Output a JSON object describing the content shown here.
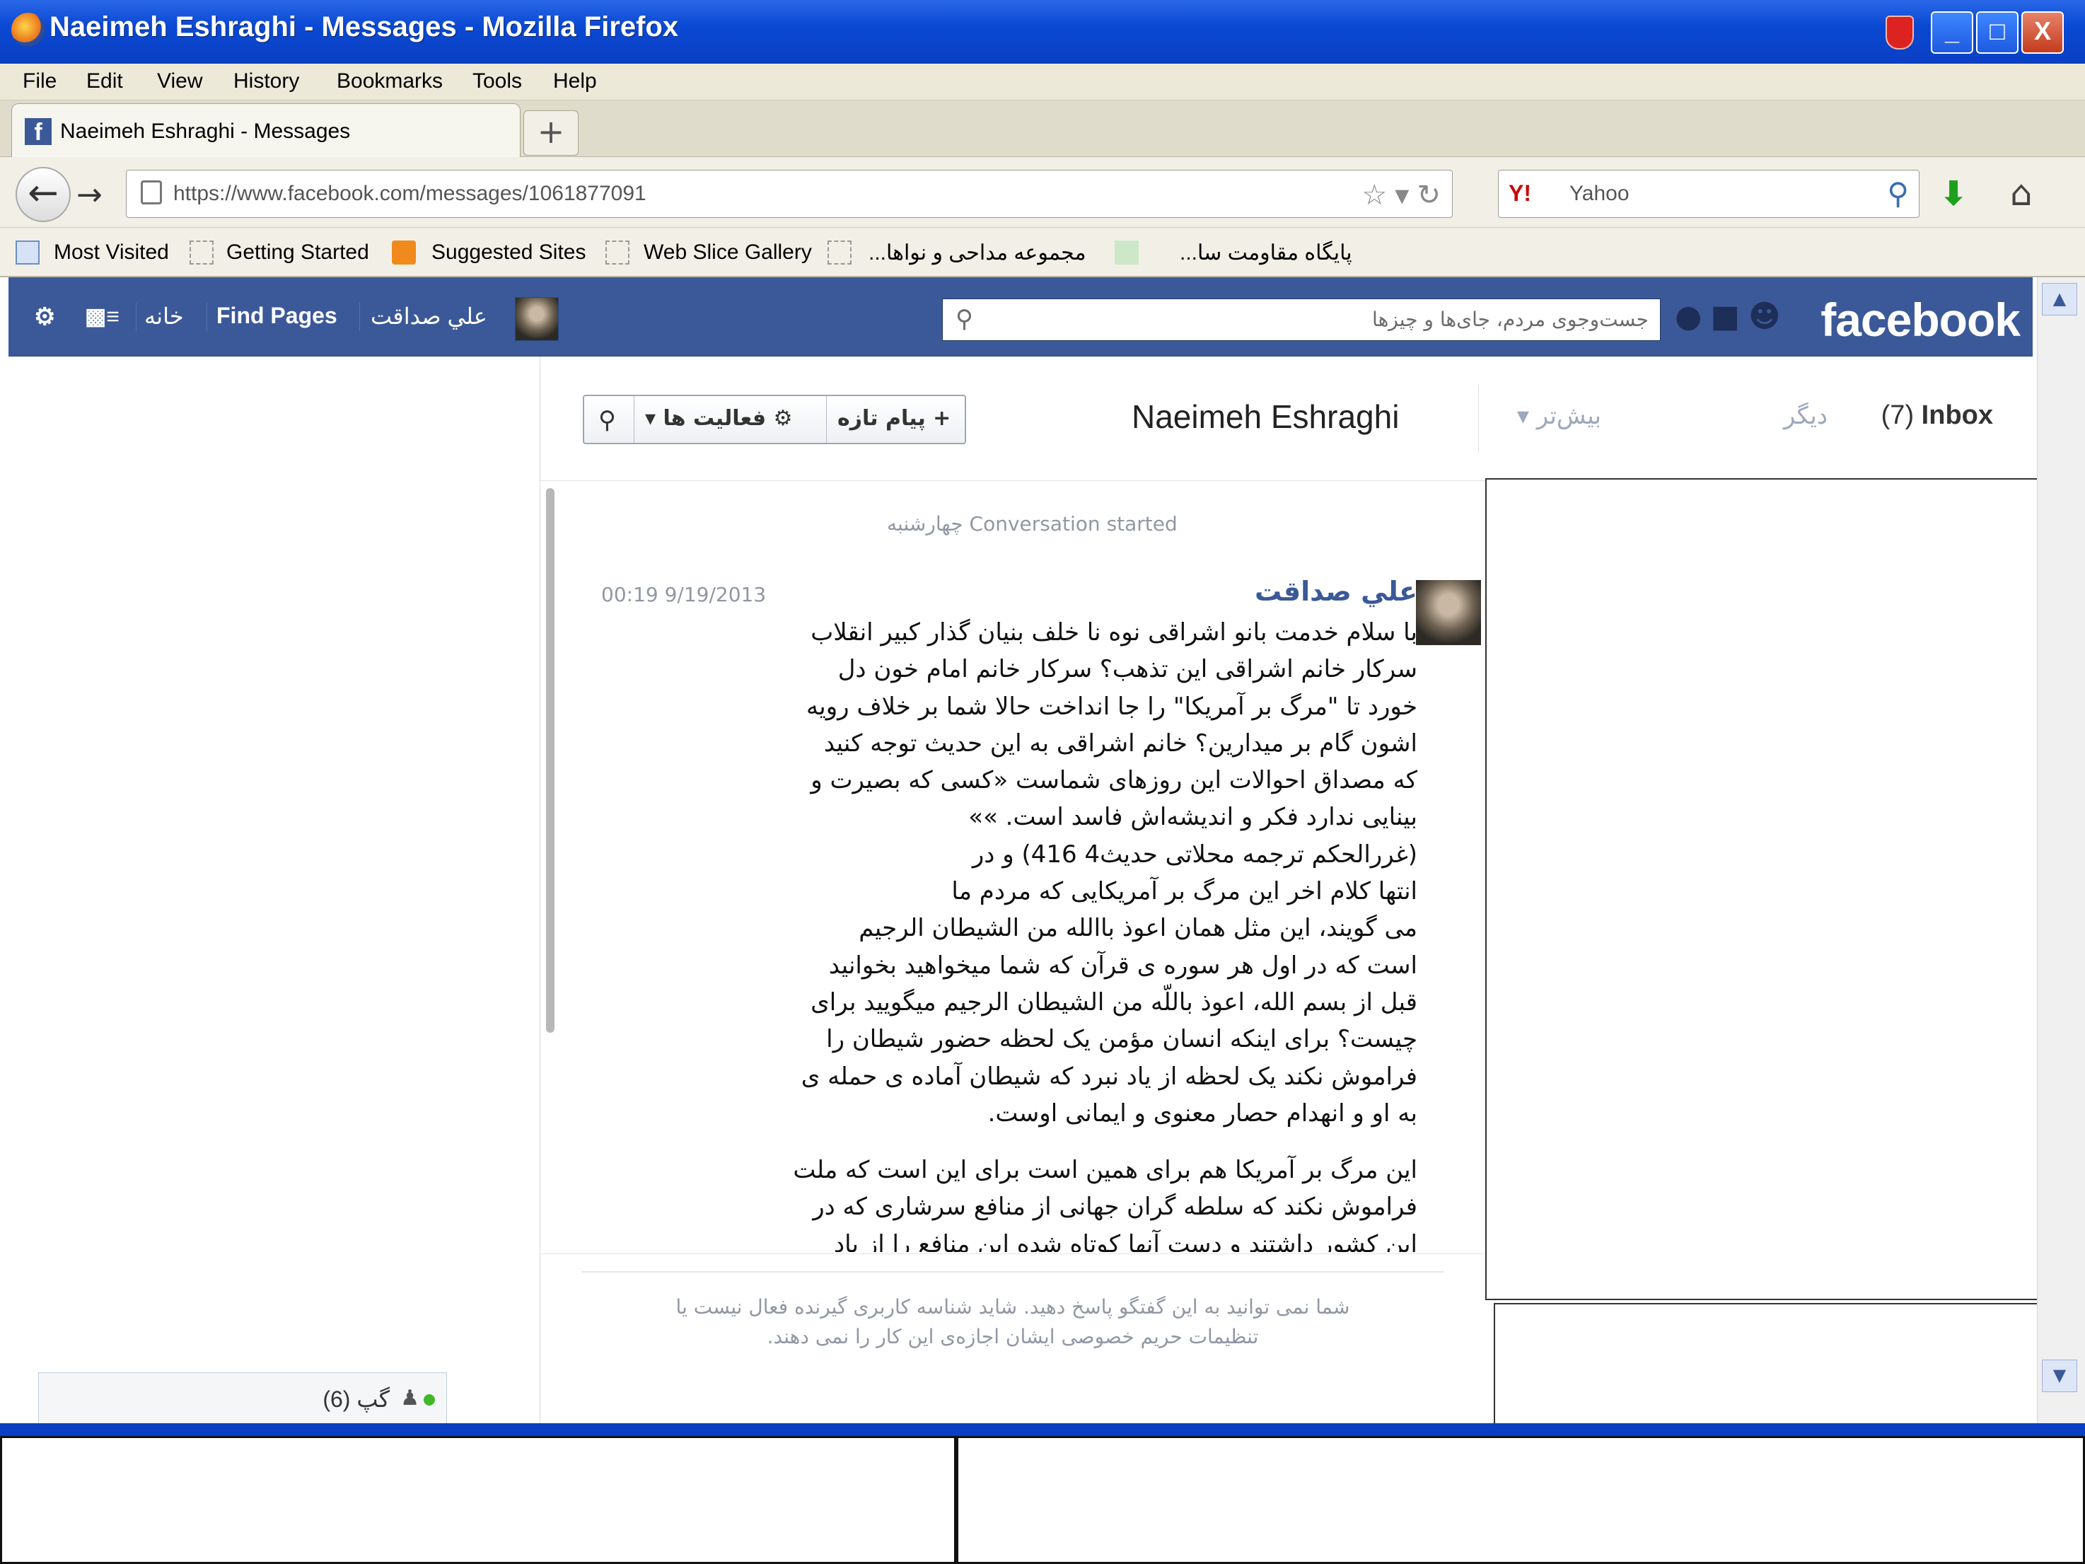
{
  "window": {
    "title": "Naeimeh Eshraghi - Messages - Mozilla Firefox",
    "buttons": [
      "_",
      "□",
      "X"
    ]
  },
  "menu": [
    "File",
    "Edit",
    "View",
    "History",
    "Bookmarks",
    "Tools",
    "Help"
  ],
  "tab": {
    "label": "Naeimeh Eshraghi - Messages",
    "new_tab": "+"
  },
  "nav": {
    "url": "https://www.facebook.com/messages/1061877091",
    "search_engine": "Yahoo",
    "search_logo": "Y!"
  },
  "bookmarks": [
    "Most Visited",
    "Getting Started",
    "Suggested Sites",
    "Web Slice Gallery",
    "مجموعه مداحی و نواها...",
    "پایگاه مقاومت سا..."
  ],
  "facebook": {
    "logo": "facebook",
    "search_placeholder": "جست‌وجوی مردم، جای‌ها و چیزها",
    "nav_user": "علي صداقت",
    "nav_find_pages": "Find Pages",
    "nav_home": "خانه"
  },
  "messages": {
    "inbox_label": "Inbox",
    "inbox_count": "(7)",
    "other_label": "دیگر",
    "more_label": "بیش‌تر",
    "conversation_name": "Naeimeh Eshraghi",
    "new_message": "+ پیام تازه",
    "actions": "فعالیت ها",
    "conversation_started": "Conversation started چهارشنبه",
    "sender": "علي صداقت",
    "timestamp": "00:19 9/19/2013",
    "lines": [
      "با سلام خدمت بانو اشراقی نوه  نا خلف بنیان گذار کبیر انقلاب",
      "سرکار خانم اشراقی این تذهب؟ سرکار خانم  امام خون دل",
      "خورد تا \"مرگ بر آمریکا\" را جا انداخت حالا شما  بر خلاف رویه",
      "اشون  گام بر میدارین؟ خانم اشراقی به این حدیث توجه کنید",
      "که مصداق احوالات این روزهای شماست   «کسی که بصیرت و",
      "بینایی ندارد فکر و اندیشه‌اش فاسد است. »»",
      "(غررالحکم ترجمه محلاتی حدیث4 416)                و در",
      "انتها  کلام اخر                این مرگ بر آمریکایی که مردم ما",
      "می گویند، این مثل همان اعوذ باالله من الشیطان الرجیم",
      "است که در اول هر سوره ی قرآن که شما میخواهید بخوانید",
      "قبل از بسم الله، اعوذ باللّه من الشیطان الرجیم میگویید برای",
      "چیست؟ برای اینکه انسان مؤمن یک لحظه حضور شیطان را",
      "فراموش نکند یک لحظه از یاد نبرد که شیطان آماده ی حمله ی",
      "به او و انهدام حصار معنوی و ایمانی اوست."
    ],
    "lines2": [
      "این مرگ بر آمریکا هم برای همین است برای این است که ملت",
      "فراموش نکند که سلطه گران جهانی از منافع سرشاری که در",
      "این کشور داشتند و دست آنها کوتاه شده این منافع را از یاد"
    ],
    "reply_note_1": "شما نمی توانید به این گفتگو پاسخ دهید. شاید شناسه کاربری گیرنده فعال نیست یا",
    "reply_note_2": "تنظیمات حریم خصوصی ایشان اجازه‌ی این کار را نمی دهند."
  },
  "chat": {
    "label": "گپ (6)"
  }
}
